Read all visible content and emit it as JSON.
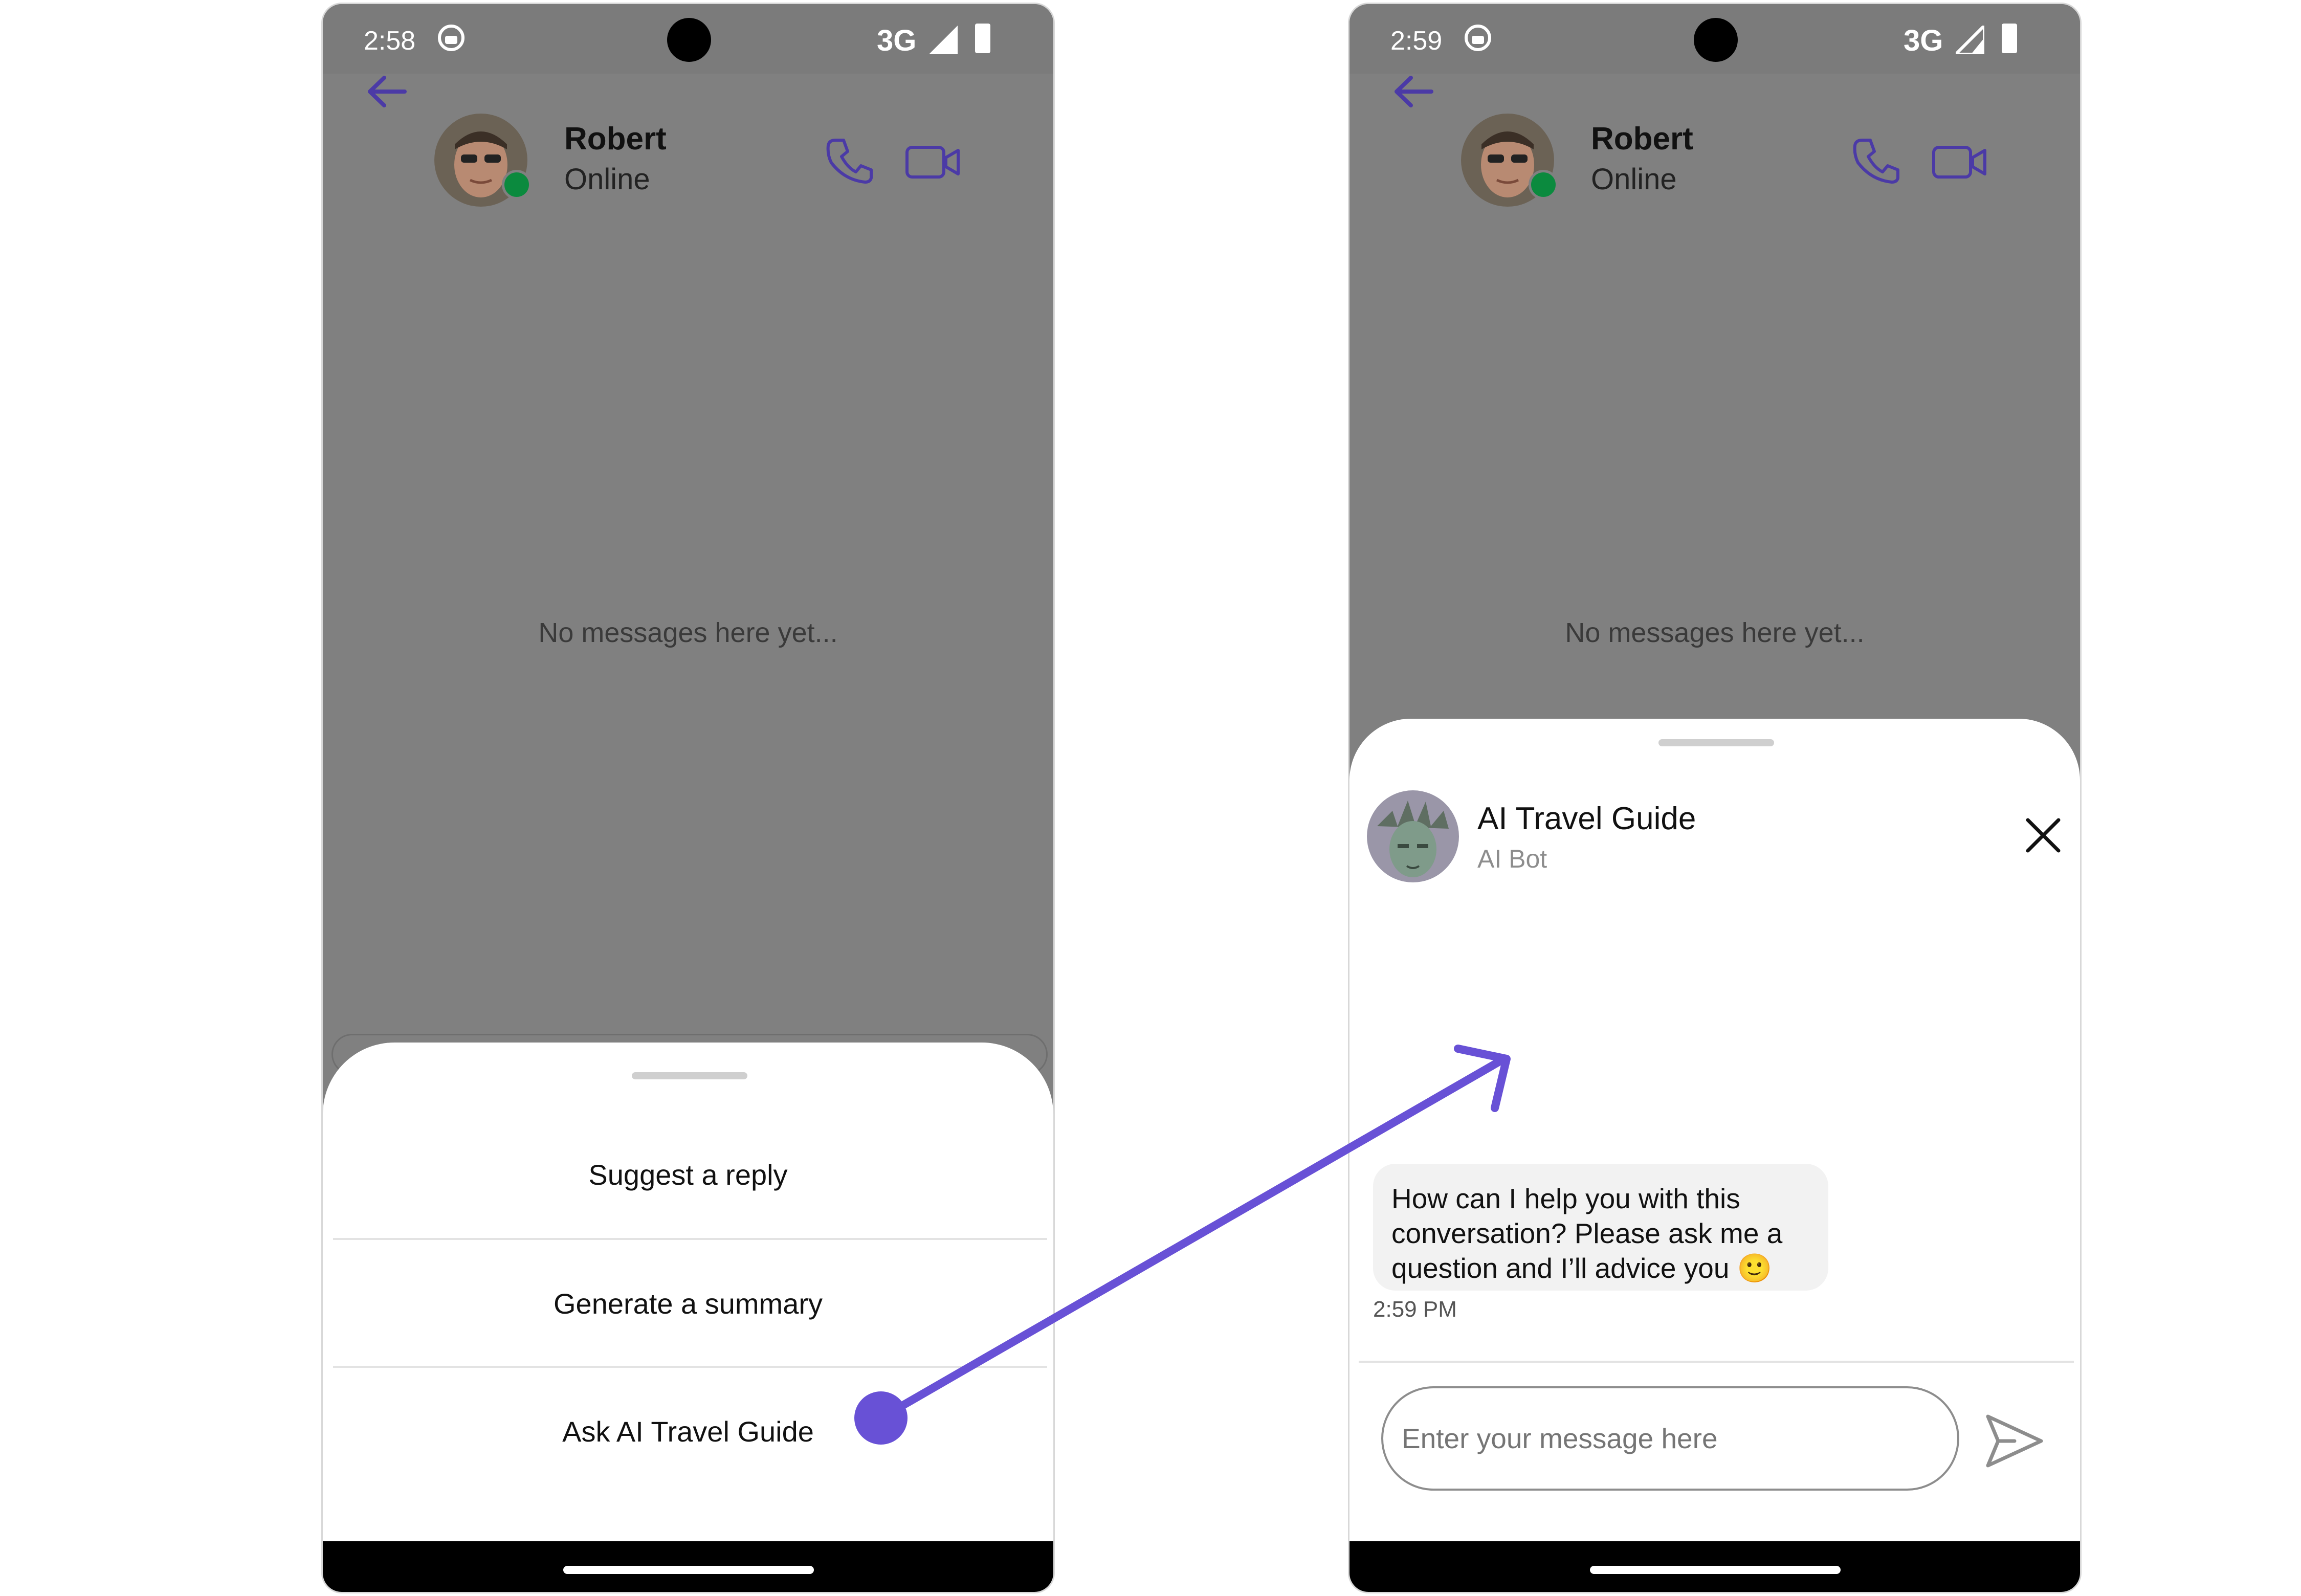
{
  "left_screen": {
    "status": {
      "time": "2:58",
      "network": "3G"
    },
    "header": {
      "name": "Robert",
      "status": "Online"
    },
    "empty_message": "No messages here yet...",
    "menu": [
      {
        "label": "Suggest a reply"
      },
      {
        "label": "Generate a summary"
      },
      {
        "label": "Ask AI Travel Guide"
      }
    ]
  },
  "right_screen": {
    "status": {
      "time": "2:59",
      "network": "3G"
    },
    "header": {
      "name": "Robert",
      "status": "Online"
    },
    "empty_message": "No messages here yet...",
    "bot": {
      "name": "AI Travel Guide",
      "subtitle": "AI Bot"
    },
    "message": {
      "line1": "How can I help you with this",
      "line2": "conversation? Please ask me a",
      "line3": "question and I’ll advice you",
      "emoji": "🙂",
      "time": "2:59 PM"
    },
    "input": {
      "placeholder": "Enter your message here"
    }
  },
  "colors": {
    "accent": "#6851d6",
    "overlay": "#808080",
    "online": "#0b8a3e",
    "icon_purple": "#4b3aa6"
  },
  "icons": [
    "back-arrow-icon",
    "phone-icon",
    "video-camera-icon",
    "close-icon",
    "send-icon",
    "signal-icon",
    "battery-icon"
  ]
}
